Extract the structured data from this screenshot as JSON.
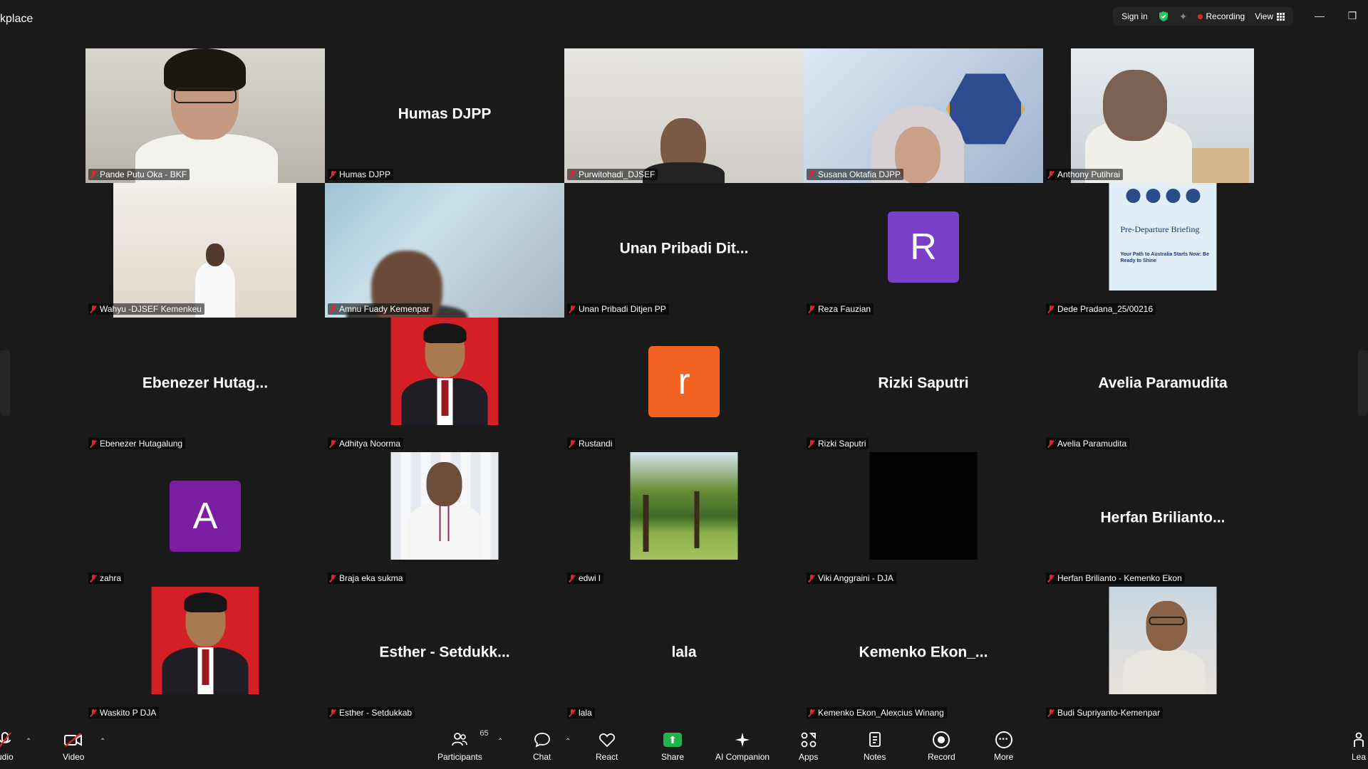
{
  "app": {
    "title": "kplace"
  },
  "topbar": {
    "sign_in": "Sign in",
    "recording": "Recording",
    "view": "View",
    "icons": [
      "shield-check-icon",
      "sparkle-icon",
      "record-dot-icon",
      "grid-icon"
    ],
    "window_controls": [
      "minimize-icon",
      "restore-icon"
    ]
  },
  "colors": {
    "background": "#1a1a1a",
    "active_speaker_border": "#22c55e",
    "share_green": "#22b24c",
    "mute_red": "#e02828",
    "avatar_purple": "#7b3fc7",
    "avatar_orange": "#f26322"
  },
  "participants": [
    {
      "label": "Pande Putu Oka - BKF",
      "big": "",
      "kind": "photo-woman",
      "active": true
    },
    {
      "label": "Humas DJPP",
      "big": "Humas DJPP",
      "kind": "name"
    },
    {
      "label": "Purwitohadi_DJSEF",
      "big": "",
      "kind": "photo-man1"
    },
    {
      "label": "Susana Oktafia DJPP",
      "big": "",
      "kind": "photo-banner"
    },
    {
      "label": "Anthony Putihrai",
      "big": "",
      "kind": "photo-office"
    },
    {
      "label": "Wahyu -DJSEF Kemenkeu",
      "big": "",
      "kind": "photo-lobby"
    },
    {
      "label": "Amnu Fuady Kemenpar",
      "big": "",
      "kind": "photo-blur"
    },
    {
      "label": "Unan Pribadi Ditjen PP",
      "big": "Unan Pribadi Dit...",
      "kind": "name"
    },
    {
      "label": "Reza Fauzian",
      "big": "",
      "kind": "avatar",
      "letter": "R",
      "color": "#7b3fc7"
    },
    {
      "label": "Dede Pradana_25/00216",
      "big": "",
      "kind": "photo-briefing",
      "briefing_title": "Pre-Departure Briefing",
      "briefing_sub": "Your Path to Australia Starts Now: Be Ready to Shine"
    },
    {
      "label": "Ebenezer Hutagalung",
      "big": "Ebenezer Hutag...",
      "kind": "name"
    },
    {
      "label": "Adhitya Noorma",
      "big": "",
      "kind": "photo-redbg"
    },
    {
      "label": "Rustandi",
      "big": "",
      "kind": "avatar",
      "letter": "r",
      "color": "#f26322"
    },
    {
      "label": "Rizki Saputri",
      "big": "Rizki Saputri",
      "kind": "name"
    },
    {
      "label": "Avelia Paramudita",
      "big": "Avelia Paramudita",
      "kind": "name"
    },
    {
      "label": "zahra",
      "big": "",
      "kind": "avatar",
      "letter": "A",
      "color": "#7b1fa2"
    },
    {
      "label": "Braja eka sukma",
      "big": "",
      "kind": "photo-banner2"
    },
    {
      "label": "edwi l",
      "big": "",
      "kind": "photo-park"
    },
    {
      "label": "Viki Anggraini - DJA",
      "big": "",
      "kind": "photo-black"
    },
    {
      "label": "Herfan Brilianto - Kemenko Ekon",
      "big": "Herfan  Brilianto...",
      "kind": "name"
    },
    {
      "label": "Waskito P DJA",
      "big": "",
      "kind": "photo-redbg"
    },
    {
      "label": "Esther - Setdukkab",
      "big": "Esther  -  Setdukk...",
      "kind": "name"
    },
    {
      "label": "lala",
      "big": "lala",
      "kind": "name"
    },
    {
      "label": "Kemenko Ekon_Alexcius Winang",
      "big": "Kemenko  Ekon_...",
      "kind": "name"
    },
    {
      "label": "Budi Supriyanto-Kemenpar",
      "big": "",
      "kind": "photo-selfie"
    }
  ],
  "toolbar": {
    "audio": "udio",
    "video": "Video",
    "participants": "Participants",
    "participants_count": "65",
    "chat": "Chat",
    "react": "React",
    "share": "Share",
    "ai_companion": "AI Companion",
    "apps": "Apps",
    "notes": "Notes",
    "record": "Record",
    "more": "More",
    "leave": "Lea"
  }
}
